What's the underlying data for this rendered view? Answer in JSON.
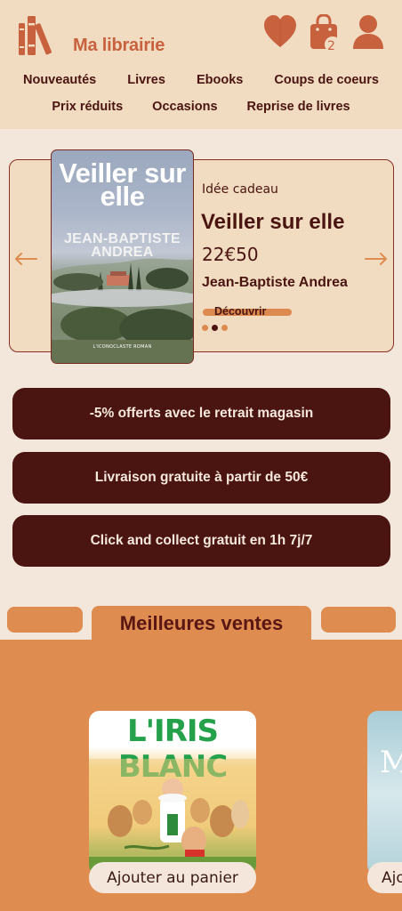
{
  "header": {
    "logo_text": "Ma librairie",
    "cart_count": "2",
    "icons": [
      "books-icon",
      "heart-icon",
      "shopping-bag-icon",
      "user-icon"
    ]
  },
  "nav": {
    "row1": [
      "Nouveautés",
      "Livres",
      "Ebooks",
      "Coups de coeurs"
    ],
    "row2": [
      "Prix réduits",
      "Occasions",
      "Reprise de livres"
    ]
  },
  "carousel": {
    "tag": "Idée cadeau",
    "title": "Veiller sur elle",
    "price": "22€50",
    "author": "Jean-Baptiste Andrea",
    "cta": "Découvrir",
    "cover": {
      "title": "Veiller sur elle",
      "author": "JEAN-BAPTISTE ANDREA",
      "publisher": "L'ICONOCLASTE ROMAN"
    },
    "slide_count": 3,
    "active_slide": 2
  },
  "pills": [
    "-5% offerts avec le retrait magasin",
    "Livraison gratuite à partir de 50€",
    "Click and collect gratuit en 1h 7j/7"
  ],
  "bestsellers": {
    "tab_label": "Meilleures ventes",
    "products": [
      {
        "cover_title": "L'IRIS BLANC",
        "add_label": "Ajouter au panier"
      },
      {
        "cover_letter": "M",
        "add_label": "Ajouter au panier"
      }
    ]
  },
  "colors": {
    "brand": "#c8613e",
    "dark": "#4a1410",
    "header_bg": "#f1dcc1",
    "page_bg": "#f3e6da",
    "orange": "#de8c4f"
  }
}
